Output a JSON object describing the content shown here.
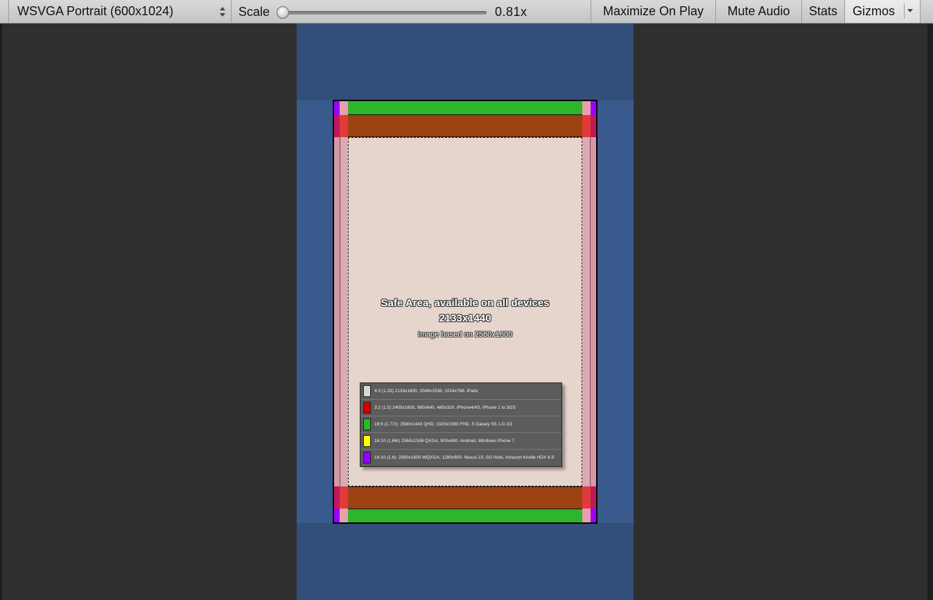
{
  "toolbar": {
    "resolution_label": "WSVGA Portrait (600x1024)",
    "scale_label": "Scale",
    "scale_value": "0.81x",
    "maximize_label": "Maximize On Play",
    "mute_label": "Mute Audio",
    "stats_label": "Stats",
    "gizmos_label": "Gizmos"
  },
  "game_view": {
    "safe_area_title": "Safe Area, available on all devices",
    "safe_area_size": "2133x1440",
    "safe_area_note": "Image based on 2560x1600",
    "legend": [
      {
        "color": "#d8d8d8",
        "text": "4:3 (1.33) 2133x1600, 2048x1536, 1024x768. iPads"
      },
      {
        "color": "#d40000",
        "text": "3:2 (1.5) 2400x1600, 960x640, 480x320. iPhone4/4S, iPhone 1 to 3GS"
      },
      {
        "color": "#22c022",
        "text": "16:9 (1.77r): 2560x1440 QHD, 1920x1080 FHD. S Galaxy S5, LG G3"
      },
      {
        "color": "#ffff00",
        "text": "16:10 (1.66r) 2560x1536 QXGA, 800x480. Android, Windows Phone 7"
      },
      {
        "color": "#9b00ff",
        "text": "16:10 (1.6): 2560x1600 WQXGA, 1280x800. Nexus 10, SG Note, Amazon Kindle HDX 8.9"
      }
    ]
  },
  "colors": {
    "toolbar_bg": "#cfcfcf",
    "editor_bg": "#2f2f2f",
    "game_bg": "#324f7a",
    "green_band": "#2db52d",
    "orange_band": "#9b4210",
    "pink_side": "#d49aa6",
    "red_corner": "#e03a3a",
    "purple_corner": "#9b00ff",
    "safe_area": "#e6d5cc"
  }
}
